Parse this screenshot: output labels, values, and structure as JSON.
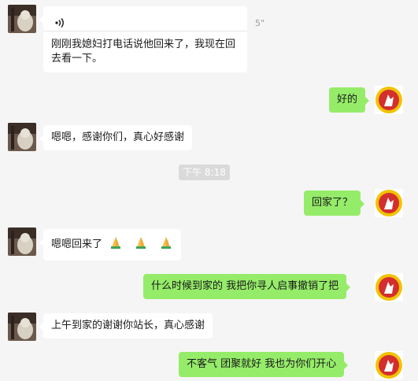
{
  "messages": [
    {
      "side": "in",
      "type": "voice",
      "duration": "5\"",
      "text": "刚刚我媳妇打电话说他回来了，我现在回去看一下。"
    },
    {
      "side": "out",
      "text": "好的"
    },
    {
      "side": "in",
      "text": "嗯嗯，感谢你们，真心好感谢"
    },
    {
      "type": "time",
      "text": "下午 8:18"
    },
    {
      "side": "out",
      "text": "回家了？"
    },
    {
      "side": "in",
      "text": "嗯嗯回来了",
      "emoji": [
        "folded-hands",
        "folded-hands",
        "folded-hands"
      ]
    },
    {
      "side": "out",
      "text": "什么时候到家的  我把你寻人启事撤销了把"
    },
    {
      "side": "in",
      "text": "上午到家的谢谢你站长，真心感谢"
    },
    {
      "side": "out",
      "text": "不客气   团聚就好 我也为你们开心"
    }
  ],
  "colors": {
    "background": "#f5f5f5",
    "incoming_bubble": "#ffffff",
    "outgoing_bubble": "#95ec69",
    "timestamp_bg": "#dadada",
    "logo_red": "#d32f2f",
    "logo_gold": "#f2c200"
  },
  "icons": {
    "voice": "voice-wave-icon",
    "contact_avatar": "contact-avatar-photo",
    "self_avatar": "red-circle-logo-icon",
    "emoji": "folded-hands-emoji"
  }
}
